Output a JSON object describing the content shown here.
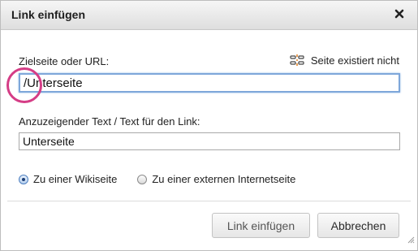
{
  "dialog": {
    "title": "Link einfügen",
    "close_icon": "close-icon"
  },
  "target": {
    "label": "Zielseite oder URL:",
    "value": "/Unterseite",
    "status_text": "Seite existiert nicht",
    "status_icon": "broken-link-icon"
  },
  "display_text": {
    "label": "Anzuzeigender Text / Text für den Link:",
    "value": "Unterseite"
  },
  "link_type": {
    "options": [
      {
        "label": "Zu einer Wikiseite",
        "checked": true
      },
      {
        "label": "Zu einer externen Internetseite",
        "checked": false
      }
    ]
  },
  "buttons": {
    "insert_label": "Link einfügen",
    "cancel_label": "Abbrechen"
  },
  "colors": {
    "focus_border": "#7ea7da",
    "highlight_circle": "#d53d86",
    "status_icon_accent": "#e07c1c"
  }
}
